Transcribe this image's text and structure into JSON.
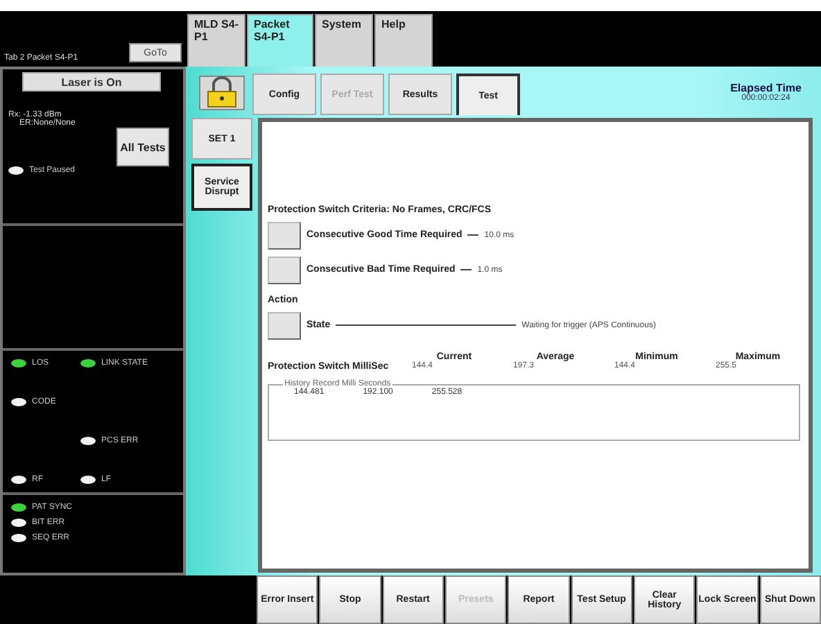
{
  "header": {
    "location": "Tab 2 Packet S4-P1",
    "goto_button": "GoTo"
  },
  "main_tabs": [
    {
      "label": "MLD S4-P1",
      "selected": false
    },
    {
      "label": "Packet S4-P1",
      "selected": true
    },
    {
      "label": "System",
      "selected": false
    },
    {
      "label": "Help",
      "selected": false
    }
  ],
  "left_panel": {
    "laser_button": "Laser is On",
    "rx_power": "Rx: -1.33 dBm",
    "er_line": "ER:None/None",
    "all_tests_button": "All Tests",
    "test_status": {
      "label": "Test Paused",
      "on": false
    },
    "led_groups": [
      {
        "rows": [
          {
            "left": {
              "label": "LOS",
              "on": true
            },
            "right": {
              "label": "LINK STATE",
              "on": true
            }
          },
          {
            "left": {
              "label": "CODE",
              "on": false
            }
          },
          {
            "right": {
              "label": "PCS ERR",
              "on": false
            }
          },
          {
            "left": {
              "label": "RF",
              "on": false
            },
            "right": {
              "label": "LF",
              "on": false
            }
          }
        ]
      },
      {
        "rows": [
          {
            "left": {
              "label": "PAT SYNC",
              "on": true
            }
          },
          {
            "left": {
              "label": "BIT ERR",
              "on": false
            }
          },
          {
            "left": {
              "label": "SEQ ERR",
              "on": false
            }
          }
        ]
      }
    ]
  },
  "sub_tabs": [
    {
      "label": "Config",
      "selected": false,
      "disabled": false
    },
    {
      "label": "Perf Test",
      "selected": false,
      "disabled": true
    },
    {
      "label": "Results",
      "selected": false,
      "disabled": false
    },
    {
      "label": "Test",
      "selected": true,
      "disabled": false
    }
  ],
  "elapsed": {
    "label": "Elapsed Time",
    "value": "000:00:02:24"
  },
  "side_tabs": [
    {
      "label": "SET 1",
      "selected": false
    },
    {
      "label": "Service Disrupt",
      "selected": true
    }
  ],
  "panel": {
    "criteria": "Protection Switch Criteria: No Frames, CRC/FCS",
    "settings": [
      {
        "label": "Consecutive Good Time Required",
        "value": "10.0 ms"
      },
      {
        "label": "Consecutive Bad Time Required",
        "value": "1.0 ms"
      }
    ],
    "action_label": "Action",
    "state": {
      "label": "State",
      "value": "Waiting for trigger (APS Continuous)"
    },
    "stats": {
      "label": "Protection Switch MilliSec",
      "columns": [
        {
          "heading": "Current",
          "value": "144.4"
        },
        {
          "heading": "Average",
          "value": "197.3"
        },
        {
          "heading": "Minimum",
          "value": "144.4"
        },
        {
          "heading": "Maximum",
          "value": "255.5"
        }
      ]
    },
    "history": {
      "legend": "History Record Milli Seconds",
      "values": [
        "144.481",
        "192.100",
        "255.528"
      ]
    }
  },
  "bottom_buttons": [
    {
      "label": "Error Insert",
      "disabled": false
    },
    {
      "label": "Stop",
      "disabled": false
    },
    {
      "label": "Restart",
      "disabled": false
    },
    {
      "label": "Presets",
      "disabled": true
    },
    {
      "label": "Report",
      "disabled": false
    },
    {
      "label": "Test Setup",
      "disabled": false
    },
    {
      "label": "Clear History",
      "disabled": false
    },
    {
      "label": "Lock Screen",
      "disabled": false
    },
    {
      "label": "Shut Down",
      "disabled": false
    }
  ]
}
